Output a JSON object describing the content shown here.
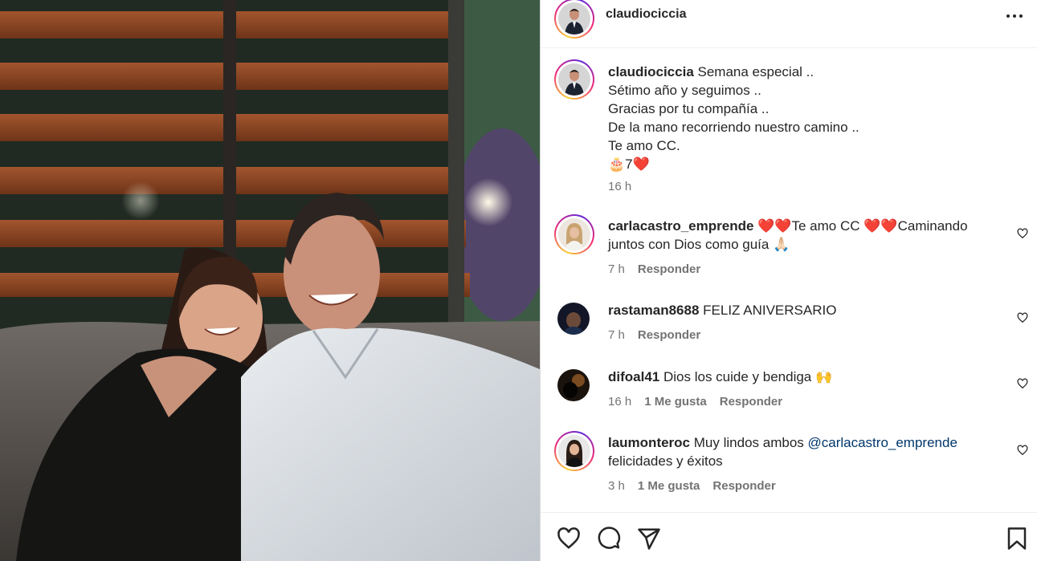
{
  "post": {
    "username": "claudiociccia",
    "photo_icon": "couple-photo",
    "more_icon": "more-options-icon"
  },
  "caption": {
    "username": "claudiociccia",
    "text": "Semana especial ..\nSétimo año y seguimos ..\nGracias por tu compañía ..\nDe la mano recorriendo nuestro camino ..\nTe amo CC.\n🎂7❤️",
    "time": "16 h"
  },
  "comments": [
    {
      "username": "carlacastro_emprende",
      "text": "❤️❤️Te amo CC ❤️❤️Caminando\njuntos con Dios como guía 🙏🏻",
      "time": "7 h",
      "likes": "",
      "reply": "Responder"
    },
    {
      "username": "rastaman8688",
      "text": "FELIZ ANIVERSARIO",
      "time": "7 h",
      "likes": "",
      "reply": "Responder"
    },
    {
      "username": "difoal41",
      "text": "Dios los cuide y bendiga 🙌",
      "time": "16 h",
      "likes": "1 Me gusta",
      "reply": "Responder"
    },
    {
      "username": "laumonteroc",
      "text_before": "Muy lindos ambos ",
      "mention": "@carlacastro_emprende",
      "text_after": "felicidades y éxitos",
      "time": "3 h",
      "likes": "1 Me gusta",
      "reply": "Responder"
    }
  ],
  "actions": {
    "like_icon": "heart-icon",
    "comment_icon": "comment-icon",
    "share_icon": "send-icon",
    "save_icon": "bookmark-icon"
  },
  "colors": {
    "text": "#262626",
    "secondary": "#737373",
    "mention": "#00376b",
    "story_ring_start": "#f9ce34",
    "story_ring_mid": "#ee2a7b",
    "story_ring_end": "#6228d7"
  }
}
